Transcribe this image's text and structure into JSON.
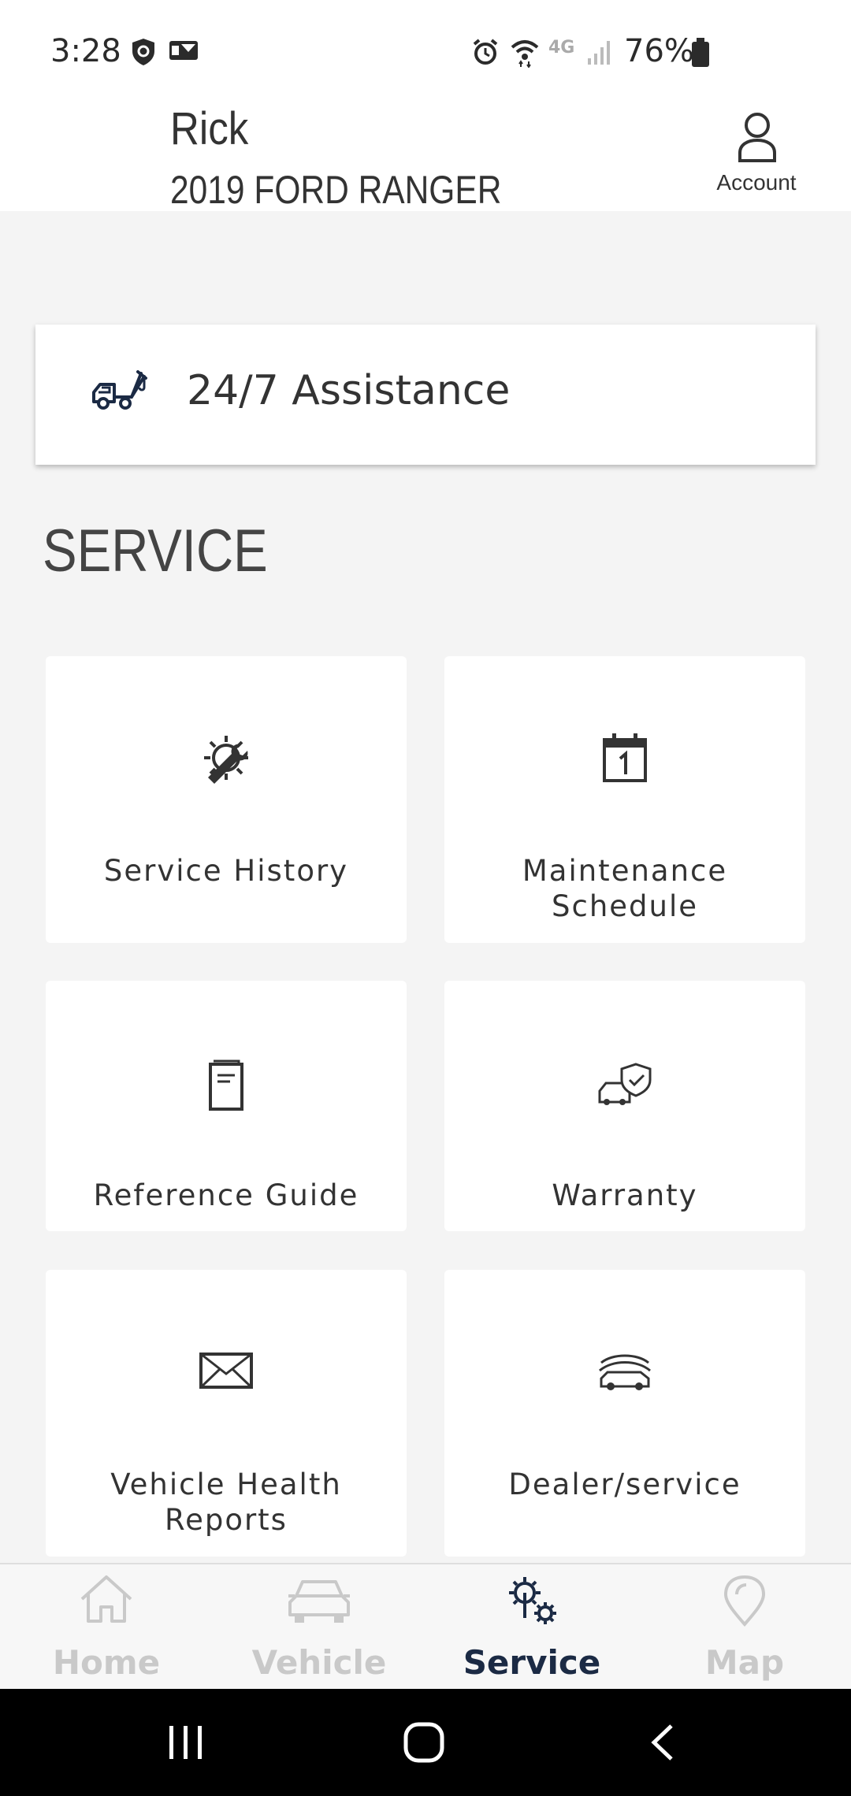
{
  "status_bar": {
    "time": "3:28",
    "network": "4G",
    "battery": "76%"
  },
  "header": {
    "user_name": "Rick",
    "vehicle": "2019 FORD RANGER",
    "account_label": "Account"
  },
  "assistance": {
    "label": "24/7 Assistance",
    "icon": "tow-truck-icon"
  },
  "section": {
    "title": "SERVICE"
  },
  "tiles": [
    {
      "label_1": "Service History",
      "label_2": "",
      "icon": "gear-wrench-icon"
    },
    {
      "label_1": "Maintenance",
      "label_2": "Schedule",
      "icon": "calendar-icon"
    },
    {
      "label_1": "Reference Guide",
      "label_2": "",
      "icon": "manual-icon"
    },
    {
      "label_1": "Warranty",
      "label_2": "",
      "icon": "car-shield-icon"
    },
    {
      "label_1": "Vehicle Health",
      "label_2": "Reports",
      "icon": "envelope-icon"
    },
    {
      "label_1": "Dealer/service",
      "label_2": "",
      "icon": "dealer-car-icon"
    }
  ],
  "bottom_nav": {
    "items": [
      {
        "label": "Home",
        "icon": "home-icon",
        "active": false
      },
      {
        "label": "Vehicle",
        "icon": "car-icon",
        "active": false
      },
      {
        "label": "Service",
        "icon": "service-gears-icon",
        "active": true
      },
      {
        "label": "Map",
        "icon": "map-pin-icon",
        "active": false
      }
    ]
  },
  "colors": {
    "background": "#f4f4f4",
    "active_nav": "#1b2a44",
    "inactive_nav": "#c9c9c9",
    "text": "#333333"
  }
}
